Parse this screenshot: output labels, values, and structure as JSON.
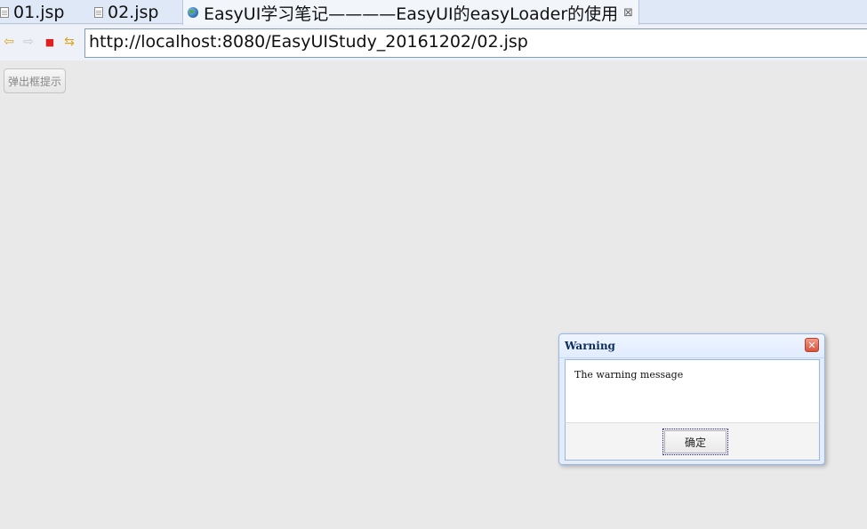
{
  "tabs": [
    {
      "label": "01.jsp",
      "icon": "document-icon"
    },
    {
      "label": "02.jsp",
      "icon": "document-icon"
    },
    {
      "label": "EasyUI学习笔记————EasyUI的easyLoader的使用",
      "icon": "globe-icon",
      "close": "⊠"
    }
  ],
  "nav": {
    "back": "⇦",
    "forward": "⇨",
    "stop": "■",
    "refresh": "⇆",
    "url": "http://localhost:8080/EasyUIStudy_20161202/02.jsp"
  },
  "page": {
    "button_label": "弹出框提示"
  },
  "dialog": {
    "title": "Warning",
    "message": "The warning message",
    "ok_label": "确定",
    "close_glyph": "✕"
  },
  "colors": {
    "page_bg": "#e9e9e9",
    "dialog_border": "#95b8e7",
    "close_red": "#d9543e",
    "stop_red": "#e02020"
  }
}
